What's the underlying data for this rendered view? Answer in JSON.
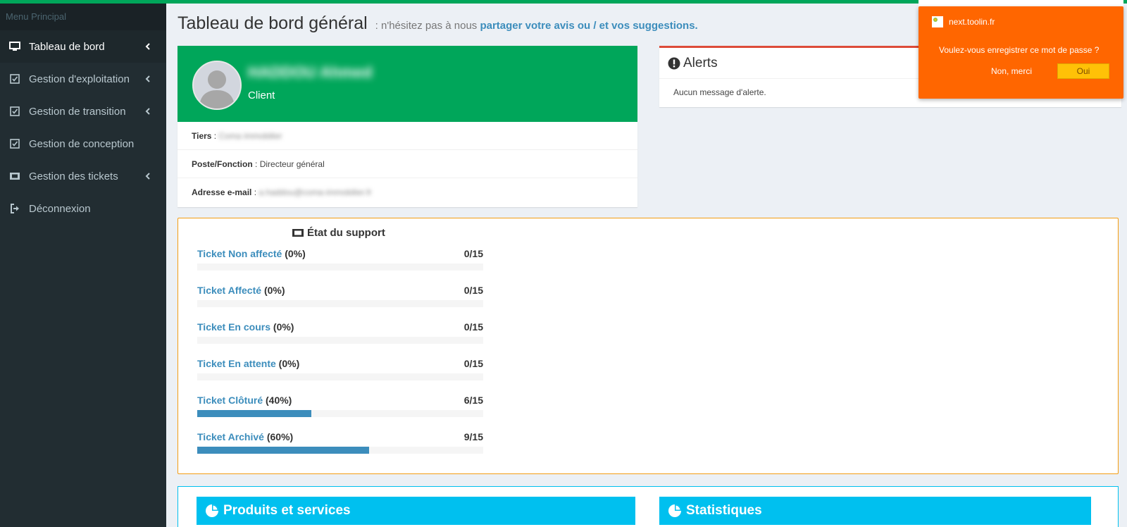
{
  "sidebar": {
    "header": "Menu Principal",
    "items": [
      {
        "label": "Tableau de bord",
        "icon": "monitor-icon"
      },
      {
        "label": "Gestion d'exploitation",
        "icon": "checkbox-icon"
      },
      {
        "label": "Gestion de transition",
        "icon": "checkbox-icon"
      },
      {
        "label": "Gestion de conception",
        "icon": "checkbox-icon"
      },
      {
        "label": "Gestion des tickets",
        "icon": "ticket-icon"
      },
      {
        "label": "Déconnexion",
        "icon": "sign-out-icon"
      }
    ]
  },
  "header": {
    "title": "Tableau de bord général",
    "subtitle_prefix": ": n'hésitez pas à nous",
    "subtitle_link": "partager votre avis ou / et vos suggestions."
  },
  "profile": {
    "name": "HADDOU Ahmed",
    "role": "Client",
    "tiers_label": "Tiers",
    "tiers_value": "Coma immobilier",
    "poste_label": "Poste/Fonction",
    "poste_value": "Directeur général",
    "email_label": "Adresse e-mail",
    "email_value": "a.haddou@coma-immobilier.fr"
  },
  "alerts": {
    "title": "Alerts",
    "message": "Aucun message d'alerte."
  },
  "password_popup": {
    "site": "next.toolin.fr",
    "question": "Voulez-vous enregistrer ce mot de passe ?",
    "no_label": "Non, merci",
    "yes_label": "Oui"
  },
  "support": {
    "title": "État du support",
    "tickets": [
      {
        "name": "Ticket Non affecté",
        "pct": "(0%)",
        "count": "0/15",
        "fraction": 0.0
      },
      {
        "name": "Ticket Affecté",
        "pct": "(0%)",
        "count": "0/15",
        "fraction": 0.0
      },
      {
        "name": "Ticket En cours",
        "pct": "(0%)",
        "count": "0/15",
        "fraction": 0.0
      },
      {
        "name": "Ticket En attente",
        "pct": "(0%)",
        "count": "0/15",
        "fraction": 0.0
      },
      {
        "name": "Ticket Clôturé",
        "pct": "(40%)",
        "count": "6/15",
        "fraction": 0.4
      },
      {
        "name": "Ticket Archivé",
        "pct": "(60%)",
        "count": "9/15",
        "fraction": 0.6
      }
    ]
  },
  "bottom": {
    "products_title": "Produits et services",
    "stats_title": "Statistiques"
  },
  "colors": {
    "accent_green": "#00a65a",
    "link_blue": "#3c8dbc",
    "sidebar_bg": "#222d32",
    "popup_orange": "#ff6600",
    "info_cyan": "#00c0ef"
  }
}
